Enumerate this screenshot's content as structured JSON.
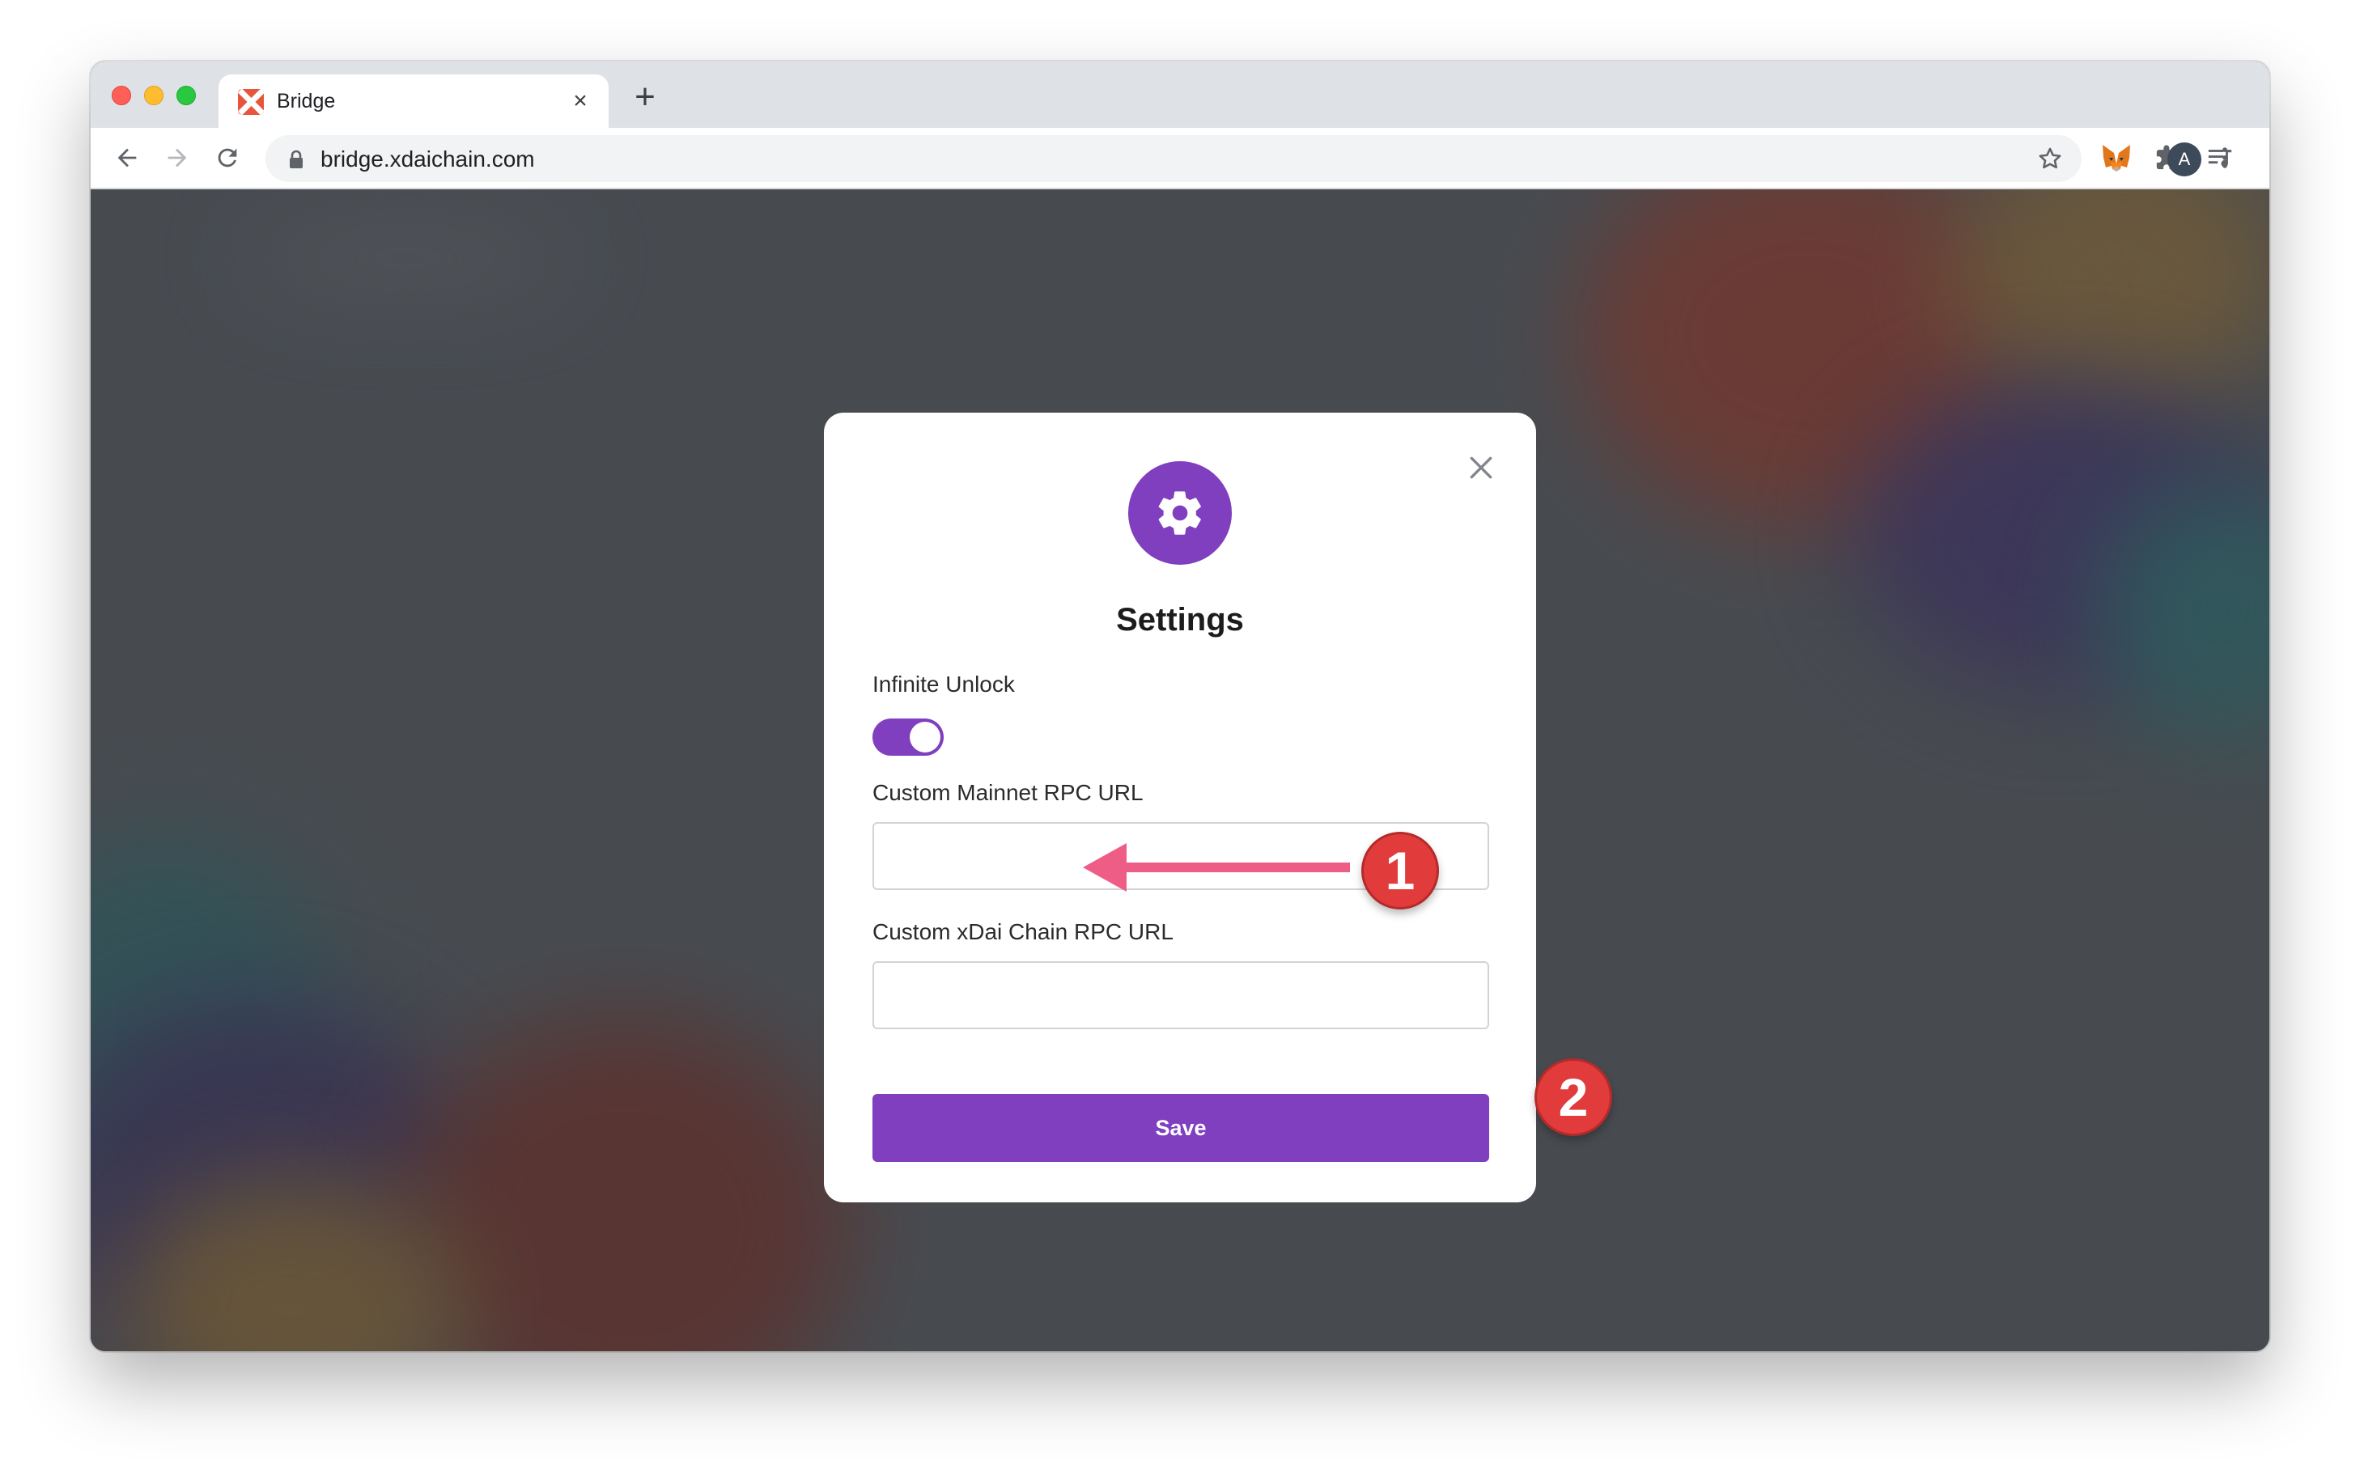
{
  "browser": {
    "tab_title": "Bridge",
    "tab_close_glyph": "×",
    "new_tab_glyph": "+",
    "url": "bridge.xdaichain.com",
    "profile_initial": "A"
  },
  "modal": {
    "title": "Settings",
    "infinite_unlock_label": "Infinite Unlock",
    "infinite_unlock_enabled": true,
    "mainnet_rpc_label": "Custom Mainnet RPC URL",
    "mainnet_rpc_value": "",
    "xdai_rpc_label": "Custom xDai Chain RPC URL",
    "xdai_rpc_value": "",
    "save_label": "Save"
  },
  "annotations": {
    "step1": "1",
    "step2": "2"
  },
  "colors": {
    "accent_purple": "#7f3fbf",
    "badge_red": "#e23b3b",
    "arrow_pink": "#ee5d86",
    "backdrop": "#474b50"
  },
  "icons": [
    "back-arrow-icon",
    "forward-arrow-icon",
    "reload-icon",
    "lock-icon",
    "star-icon",
    "metamask-fox-icon",
    "extensions-puzzle-icon",
    "media-queue-icon",
    "menu-kebab-icon",
    "gear-icon",
    "close-icon"
  ]
}
